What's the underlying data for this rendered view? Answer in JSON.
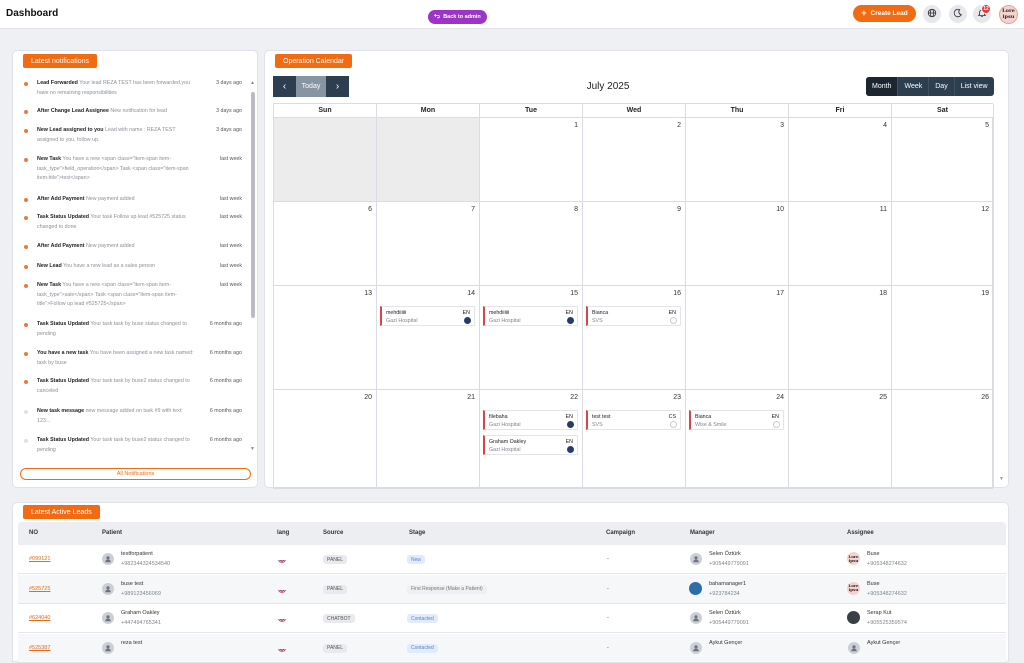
{
  "header": {
    "title": "Dashboard",
    "back_label": "Back to admin",
    "create_label": "Create Lead",
    "notif_count": "12",
    "avatar_text": "Lore\nipsu"
  },
  "notifications": {
    "title": "Latest notifications",
    "all_label": "All Notifications",
    "items": [
      {
        "title": "Lead Forwarded",
        "body": "Your lead REZA TEST has been forwarded,you have no remaining responsibilities",
        "time": "3 days ago",
        "dot": "orange"
      },
      {
        "title": "After Change Lead Assignee",
        "body": "New notification for lead",
        "time": "3 days ago",
        "dot": "orange"
      },
      {
        "title": "New Lead assigned to you",
        "body": "Lead with name : REZA TEST assigned to you, follow up.",
        "time": "3 days ago",
        "dot": "orange"
      },
      {
        "title": "New Task",
        "body": "You have a new <span class=\"item-span item-task_type\">field_operation</span> Task <span class=\"item-span item-title\">test</span>",
        "time": "last week",
        "dot": "orange"
      },
      {
        "title": "After Add Payment",
        "body": "New payment added",
        "time": "last week",
        "dot": "orange"
      },
      {
        "title": "Task Status Updated",
        "body": "Your task Follow up lead #525725 status changed to done",
        "time": "last week",
        "dot": "orange"
      },
      {
        "title": "After Add Payment",
        "body": "New payment added",
        "time": "last week",
        "dot": "orange"
      },
      {
        "title": "New Lead",
        "body": "You have a new lead as a sales person",
        "time": "last week",
        "dot": "orange"
      },
      {
        "title": "New Task",
        "body": "You have a new <span class=\"item-span item-task_type\">sale</span> Task <span class=\"item-span item-title\">Follow up lead #525725</span>",
        "time": "last week",
        "dot": "orange"
      },
      {
        "title": "Task Status Updated",
        "body": "Your task task by buse status changed to pending",
        "time": "6 months ago",
        "dot": "orange"
      },
      {
        "title": "You have a new task",
        "body": "You have been assigned a new task named: task by buse",
        "time": "6 months ago",
        "dot": "orange"
      },
      {
        "title": "Task Status Updated",
        "body": "Your task task by buse2 status changed to canceled",
        "time": "6 months ago",
        "dot": "orange"
      },
      {
        "title": "New task message",
        "body": "new message added on task #9 with text: 123...",
        "time": "6 months ago",
        "dot": "grey"
      },
      {
        "title": "Task Status Updated",
        "body": "Your task task by buse2 status changed to pending",
        "time": "6 months ago",
        "dot": "grey"
      }
    ]
  },
  "calendar": {
    "title": "Operation Calendar",
    "month": "July 2025",
    "today_label": "Today",
    "views": [
      "Month",
      "Week",
      "Day",
      "List view"
    ],
    "active_view": "Month",
    "days": [
      "Sun",
      "Mon",
      "Tue",
      "Wed",
      "Thu",
      "Fri",
      "Sat"
    ],
    "weeks": [
      [
        "",
        "",
        "1",
        "2",
        "3",
        "4",
        "5"
      ],
      [
        "6",
        "7",
        "8",
        "9",
        "10",
        "11",
        "12"
      ],
      [
        "13",
        "14",
        "15",
        "16",
        "17",
        "18",
        "19"
      ],
      [
        "20",
        "21",
        "22",
        "23",
        "24",
        "25",
        "26"
      ]
    ],
    "events": [
      {
        "week": 2,
        "day": 1,
        "slot": 0,
        "name": "mehdiiiiii",
        "hospital": "Gazi Hospital",
        "lang": "EN",
        "status": "fill"
      },
      {
        "week": 2,
        "day": 2,
        "slot": 0,
        "name": "mehdiiiiii",
        "hospital": "Gazi Hospital",
        "lang": "EN",
        "status": "fill"
      },
      {
        "week": 2,
        "day": 3,
        "slot": 0,
        "name": "Bianca",
        "hospital": "SVS",
        "lang": "EN",
        "status": "empty"
      },
      {
        "week": 3,
        "day": 2,
        "slot": 0,
        "name": "filebaha",
        "hospital": "Gazi Hospital",
        "lang": "EN",
        "status": "fill"
      },
      {
        "week": 3,
        "day": 2,
        "slot": 1,
        "name": "Graham Oakley",
        "hospital": "Gazi Hospital",
        "lang": "EN",
        "status": "fill"
      },
      {
        "week": 3,
        "day": 3,
        "slot": 0,
        "name": "test test",
        "hospital": "SVS",
        "lang": "CS",
        "status": "empty"
      },
      {
        "week": 3,
        "day": 4,
        "slot": 0,
        "name": "Bianca",
        "hospital": "Wise & Smile",
        "lang": "EN",
        "status": "empty"
      }
    ]
  },
  "leads": {
    "title": "Latest Active Leads",
    "columns": [
      "NO",
      "Patient",
      "lang",
      "Source",
      "Stage",
      "Campaign",
      "Manager",
      "Assignee"
    ],
    "rows": [
      {
        "no": "#099121",
        "patient": "testforpatient",
        "patient_phone": "+982344324534540",
        "source": "PANEL",
        "stage": "New",
        "campaign": "-",
        "manager": "Selen Öztürk",
        "manager_phone": "+905449779091",
        "assignee": "Buse",
        "assignee_phone": "+905348274632"
      },
      {
        "no": "#525725",
        "patient": "buse test",
        "patient_phone": "+989123456069",
        "source": "PANEL",
        "stage": "First Response (Make a Patient)",
        "campaign": "-",
        "manager": "bahamanager1",
        "manager_phone": "+923784234",
        "assignee": "Buse",
        "assignee_phone": "+905348274632"
      },
      {
        "no": "#624040",
        "patient": "Graham Oakley",
        "patient_phone": "+447494765341",
        "source": "CHATBOT",
        "stage": "Contacted",
        "campaign": "-",
        "manager": "Selen Öztürk",
        "manager_phone": "+905449779091",
        "assignee": "Serap Kut",
        "assignee_phone": "+905525359574"
      },
      {
        "no": "#525387",
        "patient": "reza test",
        "patient_phone": "",
        "source": "PANEL",
        "stage": "Contacted",
        "campaign": "-",
        "manager": "Aykut Gençer",
        "manager_phone": "",
        "assignee": "Aykut Gençer",
        "assignee_phone": ""
      }
    ]
  }
}
